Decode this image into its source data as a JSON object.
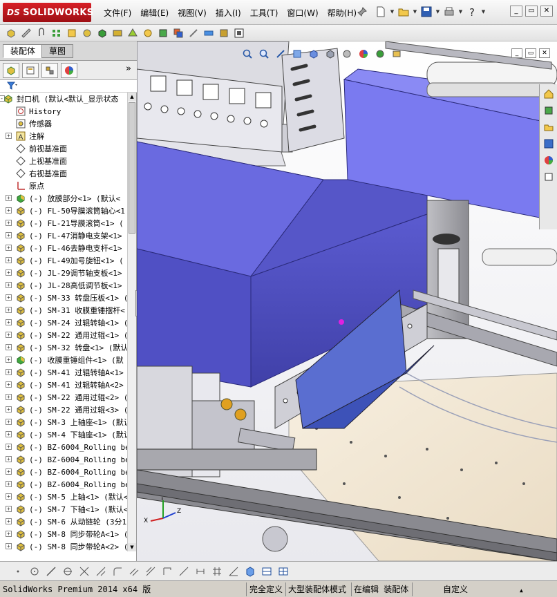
{
  "app": {
    "brand": "SOLIDWORKS",
    "brand_prefix": "DS"
  },
  "menu": [
    "文件(F)",
    "编辑(E)",
    "视图(V)",
    "插入(I)",
    "工具(T)",
    "窗口(W)",
    "帮助(H)"
  ],
  "panel": {
    "tabs": [
      "装配体",
      "草图"
    ],
    "more": "»"
  },
  "tree": [
    {
      "label": "封口机  (默认<默认_显示状态",
      "icon": "assembly-icon",
      "indent": 0,
      "expander": "-"
    },
    {
      "label": "History",
      "icon": "history-icon",
      "indent": 1,
      "expander": ""
    },
    {
      "label": "传感器",
      "icon": "sensor-icon",
      "indent": 1,
      "expander": ""
    },
    {
      "label": "注解",
      "icon": "annotation-icon",
      "indent": 1,
      "expander": "+"
    },
    {
      "label": "前视基准面",
      "icon": "plane-icon",
      "indent": 1,
      "expander": ""
    },
    {
      "label": "上视基准面",
      "icon": "plane-icon",
      "indent": 1,
      "expander": ""
    },
    {
      "label": "右视基准面",
      "icon": "plane-icon",
      "indent": 1,
      "expander": ""
    },
    {
      "label": "原点",
      "icon": "origin-icon",
      "indent": 1,
      "expander": ""
    },
    {
      "label": "(-) 放膜部分<1> (默认<",
      "icon": "subassembly-icon",
      "indent": 1,
      "expander": "+"
    },
    {
      "label": "(-) FL-50导膜滚筒轴心<1",
      "icon": "part-icon",
      "indent": 1,
      "expander": "+"
    },
    {
      "label": "(-) FL-21导膜滚筒<1> (",
      "icon": "part-icon",
      "indent": 1,
      "expander": "+"
    },
    {
      "label": "(-) FL-47消静电支架<1>",
      "icon": "part-icon",
      "indent": 1,
      "expander": "+"
    },
    {
      "label": "(-) FL-46去静电支杆<1>",
      "icon": "part-icon",
      "indent": 1,
      "expander": "+"
    },
    {
      "label": "(-) FL-49加号旋钮<1> (",
      "icon": "part-icon",
      "indent": 1,
      "expander": "+"
    },
    {
      "label": "(-) JL-29调节轴支板<1>",
      "icon": "part-icon",
      "indent": 1,
      "expander": "+"
    },
    {
      "label": "(-) JL-28高低调节板<1>",
      "icon": "part-icon",
      "indent": 1,
      "expander": "+"
    },
    {
      "label": "(-) SM-33 转盘压板<1> (",
      "icon": "part-icon",
      "indent": 1,
      "expander": "+"
    },
    {
      "label": "(-) SM-31 收膜重锤摆杆<",
      "icon": "part-icon",
      "indent": 1,
      "expander": "+"
    },
    {
      "label": "(-) SM-24 过辊转轴<1> (",
      "icon": "part-icon",
      "indent": 1,
      "expander": "+"
    },
    {
      "label": "(-) SM-22 通用过辊<1> (",
      "icon": "part-icon",
      "indent": 1,
      "expander": "+"
    },
    {
      "label": "(-) SM-32 转盘<1> (默认",
      "icon": "part-icon",
      "indent": 1,
      "expander": "+"
    },
    {
      "label": "(-) 收膜重锤组件<1> (默",
      "icon": "subassembly-icon",
      "indent": 1,
      "expander": "+"
    },
    {
      "label": "(-) SM-41 过辊转轴A<1>",
      "icon": "part-icon",
      "indent": 1,
      "expander": "+"
    },
    {
      "label": "(-) SM-41 过辊转轴A<2>",
      "icon": "part-icon",
      "indent": 1,
      "expander": "+"
    },
    {
      "label": "(-) SM-22 通用过辊<2> (",
      "icon": "part-icon",
      "indent": 1,
      "expander": "+"
    },
    {
      "label": "(-) SM-22 通用过辊<3> (",
      "icon": "part-icon",
      "indent": 1,
      "expander": "+"
    },
    {
      "label": "(-) SM-3 上轴座<1> (默认",
      "icon": "part-icon",
      "indent": 1,
      "expander": "+"
    },
    {
      "label": "(-) SM-4 下轴座<1> (默认",
      "icon": "part-icon",
      "indent": 1,
      "expander": "+"
    },
    {
      "label": "(-) BZ-6004_Rolling bea",
      "icon": "part-icon",
      "indent": 1,
      "expander": "+"
    },
    {
      "label": "(-) BZ-6004_Rolling bea",
      "icon": "part-icon",
      "indent": 1,
      "expander": "+"
    },
    {
      "label": "(-) BZ-6004_Rolling bea",
      "icon": "part-icon",
      "indent": 1,
      "expander": "+"
    },
    {
      "label": "(-) BZ-6004_Rolling bea",
      "icon": "part-icon",
      "indent": 1,
      "expander": "+"
    },
    {
      "label": "(-) SM-5 上轴<1> (默认<",
      "icon": "part-icon",
      "indent": 1,
      "expander": "+"
    },
    {
      "label": "(-) SM-7 下轴<1> (默认<",
      "icon": "part-icon",
      "indent": 1,
      "expander": "+"
    },
    {
      "label": "(-) SM-6 从动链轮 (3分1",
      "icon": "part-icon",
      "indent": 1,
      "expander": "+"
    },
    {
      "label": "(-) SM-8 同步带轮A<1> (",
      "icon": "part-icon",
      "indent": 1,
      "expander": "+"
    },
    {
      "label": "(-) SM-8 同步带轮A<2> (",
      "icon": "part-icon",
      "indent": 1,
      "expander": "+"
    }
  ],
  "status": {
    "product": "SolidWorks Premium 2014 x64 版",
    "fully_defined": "完全定义",
    "large_assembly": "大型装配体模式",
    "editing": "在编辑 装配体",
    "custom": "自定义"
  },
  "colors": {
    "accent_red": "#c8161d",
    "part_blue": "#5b5bd6",
    "toolbar_bg": "#ececec"
  }
}
